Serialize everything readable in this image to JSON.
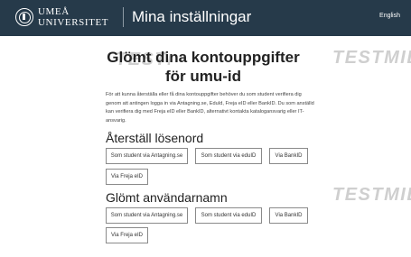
{
  "header": {
    "logo_line1": "UMEÅ",
    "logo_line2": "UNIVERSITET",
    "app_title": "Mina inställningar",
    "language_link": "English"
  },
  "watermark": "TESTMILJÖ",
  "page": {
    "title": "Glömt dina kontouppgifter för umu-id",
    "intro": "För att kunna återställa eller få dina kontouppgifter behöver du som student verifiera dig genom att antingen logga in via Antagning.se, EduId, Freja eID eller BankID. Du som anställd kan verifiera dig med Freja eID eller BankID, alternativt kontakta katalogansvarig eller IT-ansvarig."
  },
  "reset_password": {
    "heading": "Återställ lösenord",
    "buttons": {
      "antagning": "Som student via Antagning.se",
      "eduid": "Som student via eduID",
      "bankid": "Via BankID",
      "freja": "Via Freja eID"
    }
  },
  "forgot_username": {
    "heading": "Glömt användarnamn",
    "buttons": {
      "antagning": "Som student via Antagning.se",
      "eduid": "Som student via eduID",
      "bankid": "Via BankID",
      "freja": "Via Freja eID"
    }
  },
  "colors": {
    "header_bg": "#263a4a",
    "watermark": "#cfcfcf"
  }
}
